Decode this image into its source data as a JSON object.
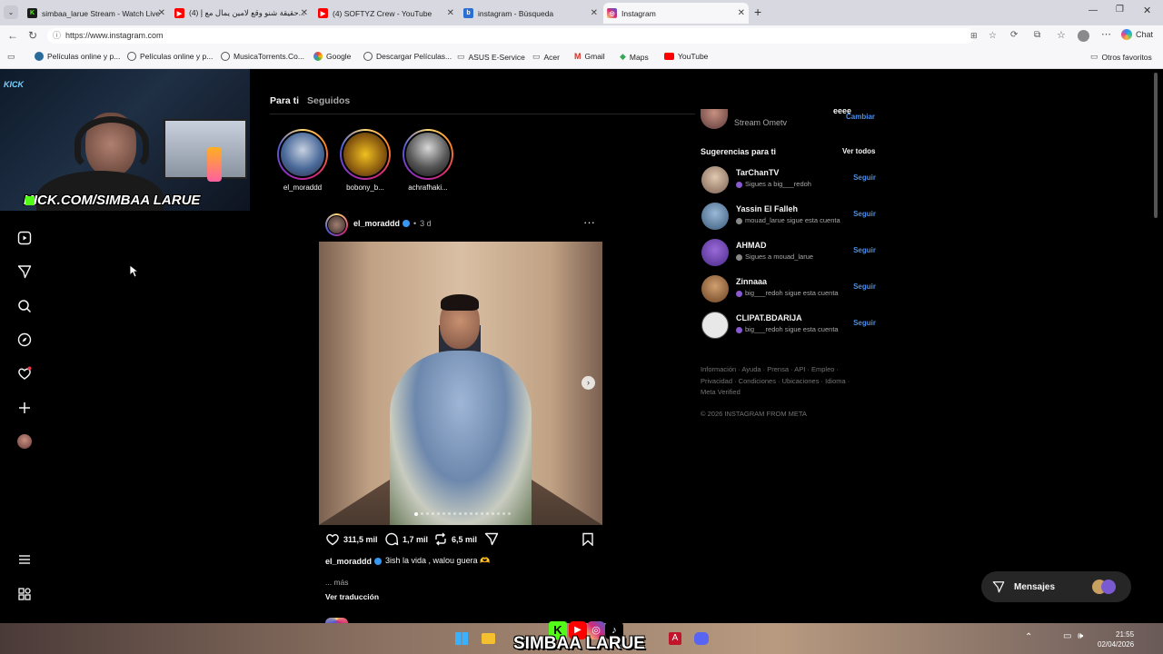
{
  "browser": {
    "tabs": [
      {
        "title": "simbaa_larue Stream - Watch Live",
        "icon": "kick-icon",
        "color": "#53fc18"
      },
      {
        "title": "(4) حقيقة شنو وقع لامين يمال مع إ...",
        "icon": "youtube-icon",
        "color": "#ff0000"
      },
      {
        "title": "(4) SOFTYZ Crew - YouTube",
        "icon": "youtube-icon",
        "color": "#ff0000"
      },
      {
        "title": "instagram - Búsqueda",
        "icon": "bing-icon",
        "color": "#2a6fd1"
      },
      {
        "title": "Instagram",
        "icon": "instagram-icon",
        "color": "#d62976"
      }
    ],
    "url": "https://www.instagram.com",
    "chat_label": "Chat",
    "bookmarks": [
      "Películas online y p...",
      "Películas online y p...",
      "MusicaTorrents.Co...",
      "Google",
      "Descargar Películas...",
      "ASUS E-Service",
      "Acer",
      "Gmail",
      "Maps",
      "YouTube"
    ],
    "other_favorites": "Otros favoritos"
  },
  "stream_overlay": {
    "kick_text": "KICK.COM/SIMBAA LARUE",
    "banner": "SIMBAA LARUE"
  },
  "feed": {
    "tab_for_you": "Para ti",
    "tab_following": "Seguidos",
    "stories": [
      {
        "name": "el_moraddd"
      },
      {
        "name": "bobony_b..."
      },
      {
        "name": "achrafhaki..."
      }
    ],
    "post": {
      "username": "el_moraddd",
      "time": "3 d",
      "likes": "311,5 mil",
      "comments": "1,7 mil",
      "reposts": "6,5 mil",
      "caption_user": "el_moraddd",
      "caption": "3ish la vida , walou guera 🫶",
      "more": "... más",
      "translate": "Ver traducción"
    }
  },
  "sidebar_right": {
    "current_user_sub": "Stream Ometv",
    "current_user_name": "eeee",
    "switch_label": "Cambiar",
    "suggestions_title": "Sugerencias para ti",
    "see_all": "Ver todos",
    "suggestions": [
      {
        "name": "TarChanTV",
        "sub": "Sigues a big___redoh",
        "action": "Seguir"
      },
      {
        "name": "Yassin El Falleh",
        "sub": "mouad_larue sigue esta cuenta",
        "action": "Seguir"
      },
      {
        "name": "AHMAD",
        "sub": "Sigues a mouad_larue",
        "action": "Seguir"
      },
      {
        "name": "Zinnaaa",
        "sub": "big___redoh sigue esta cuenta",
        "action": "Seguir"
      },
      {
        "name": "CLIPAT.BDARIJA",
        "sub": "big___redoh sigue esta cuenta",
        "action": "Seguir"
      }
    ],
    "footer_line1": "Información · Ayuda · Prensa · API · Empleo ·",
    "footer_line2": "Privacidad · Condiciones · Ubicaciones · Idioma ·",
    "footer_line3": "Meta Verified",
    "copyright": "© 2026 INSTAGRAM FROM META"
  },
  "messages_label": "Mensajes",
  "taskbar": {
    "time": "21:55",
    "date": "02/04/2026"
  }
}
